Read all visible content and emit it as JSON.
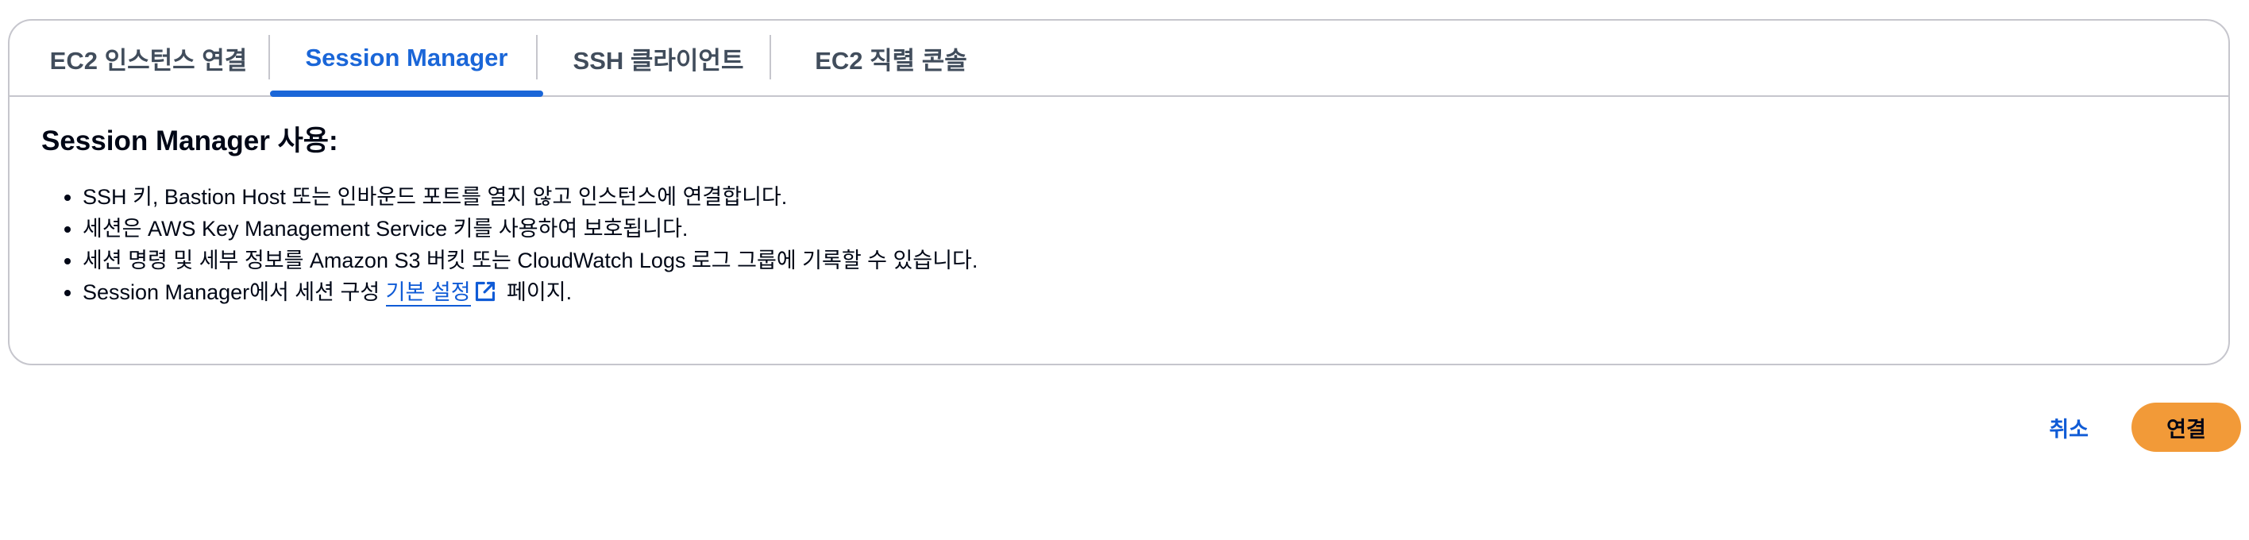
{
  "tabs": [
    {
      "label": "EC2 인스턴스 연결",
      "active": false
    },
    {
      "label": "Session Manager",
      "active": true
    },
    {
      "label": "SSH 클라이언트",
      "active": false
    },
    {
      "label": "EC2 직렬 콘솔",
      "active": false
    }
  ],
  "content": {
    "heading": "Session Manager 사용:",
    "bullets": [
      "SSH 키, Bastion Host 또는 인바운드 포트를 열지 않고 인스턴스에 연결합니다.",
      "세션은 AWS Key Management Service 키를 사용하여 보호됩니다.",
      "세션 명령 및 세부 정보를 Amazon S3 버킷 또는 CloudWatch Logs 로그 그룹에 기록할 수 있습니다."
    ],
    "last_bullet": {
      "prefix": "Session Manager에서 세션 구성 ",
      "link_text": "기본 설정",
      "suffix": " 페이지."
    }
  },
  "actions": {
    "cancel_label": "취소",
    "connect_label": "연결"
  },
  "colors": {
    "accent_blue": "#1a66d8",
    "primary_button": "#f29a38",
    "border": "#c6c6cd"
  },
  "icons": {
    "external_link": "external-link-icon"
  }
}
